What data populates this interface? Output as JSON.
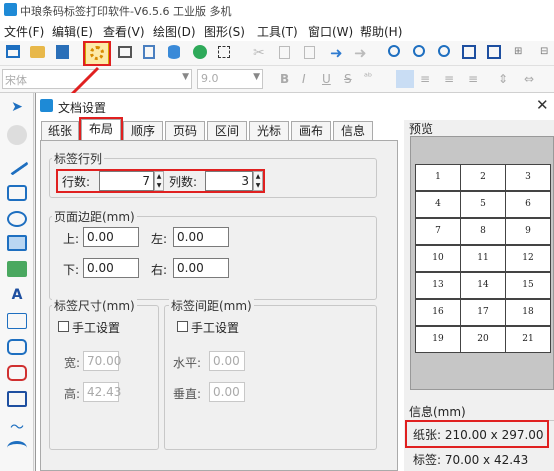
{
  "window": {
    "title": "中琅条码标签打印软件-V6.5.6 工业版 多机"
  },
  "menu": [
    "文件(F)",
    "编辑(E)",
    "查看(V)",
    "绘图(D)",
    "图形(S)",
    "工具(T)",
    "窗口(W)",
    "帮助(H)"
  ],
  "format_bar": {
    "font_name": "宋体",
    "font_size": "9.0"
  },
  "dialog": {
    "title": "文档设置",
    "tabs": [
      "纸张",
      "布局",
      "顺序",
      "页码",
      "区间",
      "光标",
      "画布",
      "信息"
    ],
    "active_tab": "布局",
    "label_layout": {
      "group_title": "标签行列",
      "rows_label": "行数:",
      "rows": "7",
      "cols_label": "列数:",
      "cols": "3"
    },
    "margins": {
      "group_title": "页面边距(mm)",
      "top_label": "上:",
      "top": "0.00",
      "left_label": "左:",
      "left": "0.00",
      "bottom_label": "下:",
      "bottom": "0.00",
      "right_label": "右:",
      "right": "0.00"
    },
    "label_size": {
      "group_title": "标签尺寸(mm)",
      "manual_label": "手工设置",
      "width_label": "宽:",
      "width": "70.00",
      "height_label": "高:",
      "height": "42.43"
    },
    "label_spacing": {
      "group_title": "标签间距(mm)",
      "manual_label": "手工设置",
      "h_label": "水平:",
      "h": "0.00",
      "v_label": "垂直:",
      "v": "0.00"
    },
    "preview": {
      "title": "预览",
      "cells": [
        "1",
        "2",
        "3",
        "4",
        "5",
        "6",
        "7",
        "8",
        "9",
        "10",
        "11",
        "12",
        "13",
        "14",
        "15",
        "16",
        "17",
        "18",
        "19",
        "20",
        "21"
      ]
    },
    "info": {
      "title": "信息(mm)",
      "paper": "纸张: 210.00 x 297.00",
      "label": "标签: 70.00 x 42.43"
    }
  },
  "colors": {
    "highlight": "#e02020",
    "preview_bg": "#c6c6c6"
  }
}
